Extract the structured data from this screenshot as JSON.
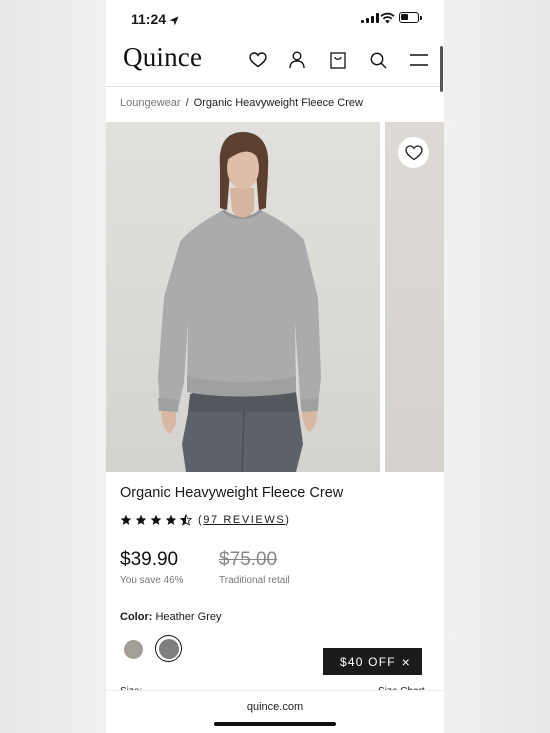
{
  "status_bar": {
    "time": "11:24"
  },
  "header": {
    "logo": "Quince"
  },
  "breadcrumb": {
    "parent": "Loungewear",
    "separator": "/",
    "current": "Organic Heavyweight Fleece Crew"
  },
  "product": {
    "title": "Organic Heavyweight Fleece Crew",
    "rating": 4.5,
    "reviews_label": "97 REVIEWS",
    "price": "$39.90",
    "savings": "You save 46%",
    "compare_price": "$75.00",
    "compare_label": "Traditional retail",
    "color_label": "Color:",
    "color_value": "Heather Grey",
    "size_label": "Size:",
    "size_chart_label": "Size Chart",
    "swatches": [
      {
        "name": "Oatmeal",
        "color": "#a39e97",
        "selected": false
      },
      {
        "name": "Heather Grey",
        "color": "#7f7f80",
        "selected": true
      }
    ]
  },
  "promo": {
    "label": "$40 OFF"
  },
  "browser": {
    "url": "quince.com"
  }
}
